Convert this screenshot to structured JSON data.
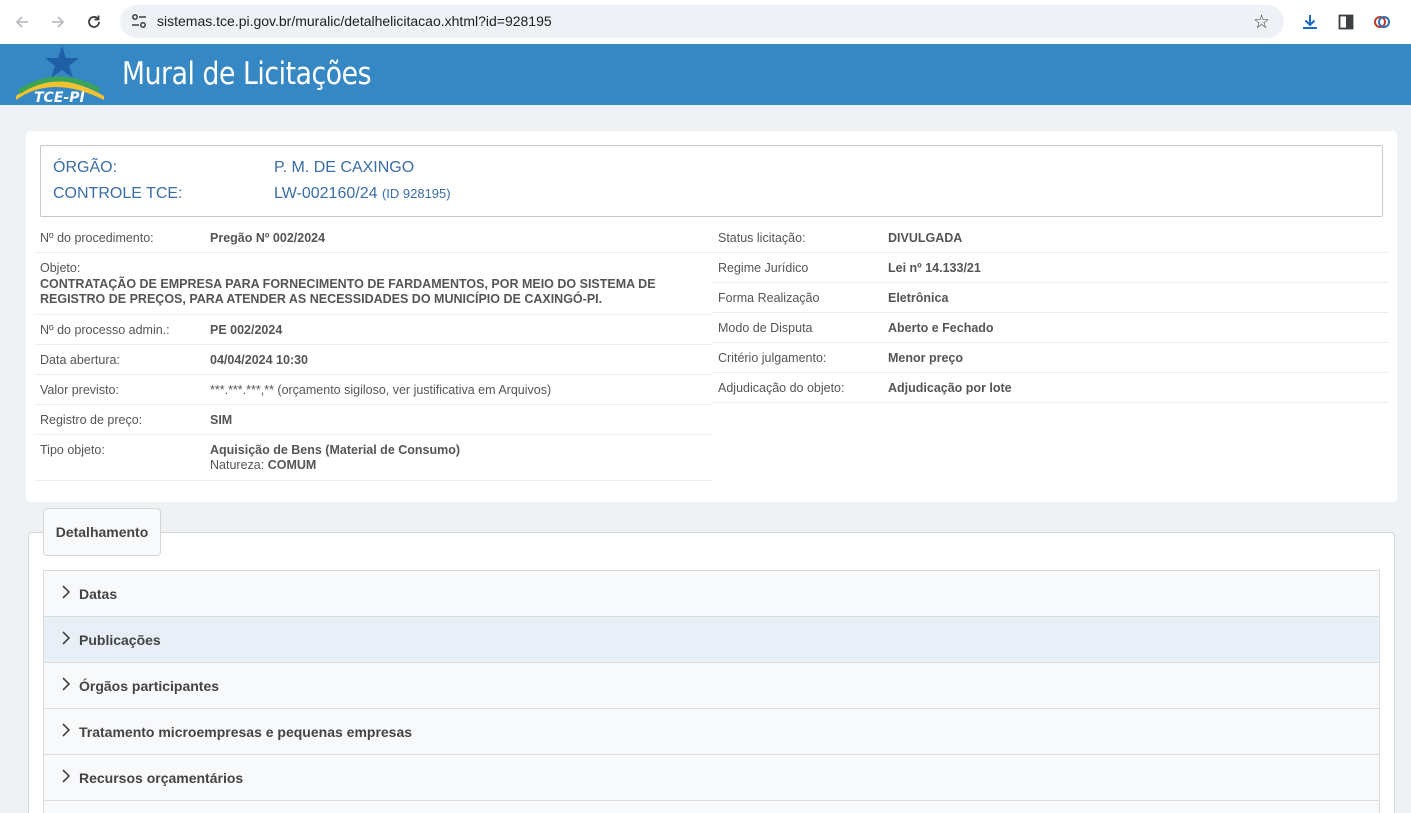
{
  "browser": {
    "url": "sistemas.tce.pi.gov.br/muralic/detalhelicitacao.xhtml?id=928195"
  },
  "header": {
    "title": "Mural de Licitações",
    "logo_text": "TCE-PI"
  },
  "orgao": {
    "orgao_label": "ÓRGÃO:",
    "orgao_value": "P. M. DE CAXINGO",
    "controle_label": "CONTROLE TCE:",
    "controle_value": "LW-002160/24",
    "controle_id": "(ID 928195)"
  },
  "left_fields": {
    "procedimento": {
      "label": "Nº do procedimento:",
      "value": "Pregão Nº 002/2024"
    },
    "objeto": {
      "label": "Objeto:",
      "value": "CONTRATAÇÃO DE EMPRESA PARA FORNECIMENTO DE FARDAMENTOS, POR MEIO DO SISTEMA DE REGISTRO DE PREÇOS, PARA ATENDER AS NECESSIDADES DO MUNICÍPIO DE CAXINGÓ-PI."
    },
    "processo": {
      "label": "Nº do processo admin.:",
      "value": "PE 002/2024"
    },
    "abertura": {
      "label": "Data abertura:",
      "value": "04/04/2024 10:30"
    },
    "valor": {
      "label": "Valor previsto:",
      "value": "***.***.***,** (orçamento sigiloso, ver justificativa em Arquivos)"
    },
    "registro": {
      "label": "Registro de preço:",
      "value": "SIM"
    },
    "tipo": {
      "label": "Tipo objeto:",
      "value": "Aquisição de Bens (Material de Consumo)",
      "natureza_label": "Natureza:",
      "natureza_value": "COMUM"
    }
  },
  "right_fields": {
    "status": {
      "label": "Status licitação:",
      "value": "DIVULGADA"
    },
    "regime": {
      "label": "Regime Jurídico",
      "value": "Lei nº 14.133/21"
    },
    "forma": {
      "label": "Forma Realização",
      "value": "Eletrônica"
    },
    "modo": {
      "label": "Modo de Disputa",
      "value": "Aberto e Fechado"
    },
    "criterio": {
      "label": "Critério julgamento:",
      "value": "Menor preço"
    },
    "adjudicacao": {
      "label": "Adjudicação do objeto:",
      "value": "Adjudicação por lote"
    }
  },
  "detalhamento": {
    "tab_label": "Detalhamento",
    "items": [
      {
        "label": "Datas"
      },
      {
        "label": "Publicações"
      },
      {
        "label": "Órgãos participantes"
      },
      {
        "label": "Tratamento microempresas e pequenas empresas"
      },
      {
        "label": "Recursos orçamentários"
      }
    ]
  }
}
